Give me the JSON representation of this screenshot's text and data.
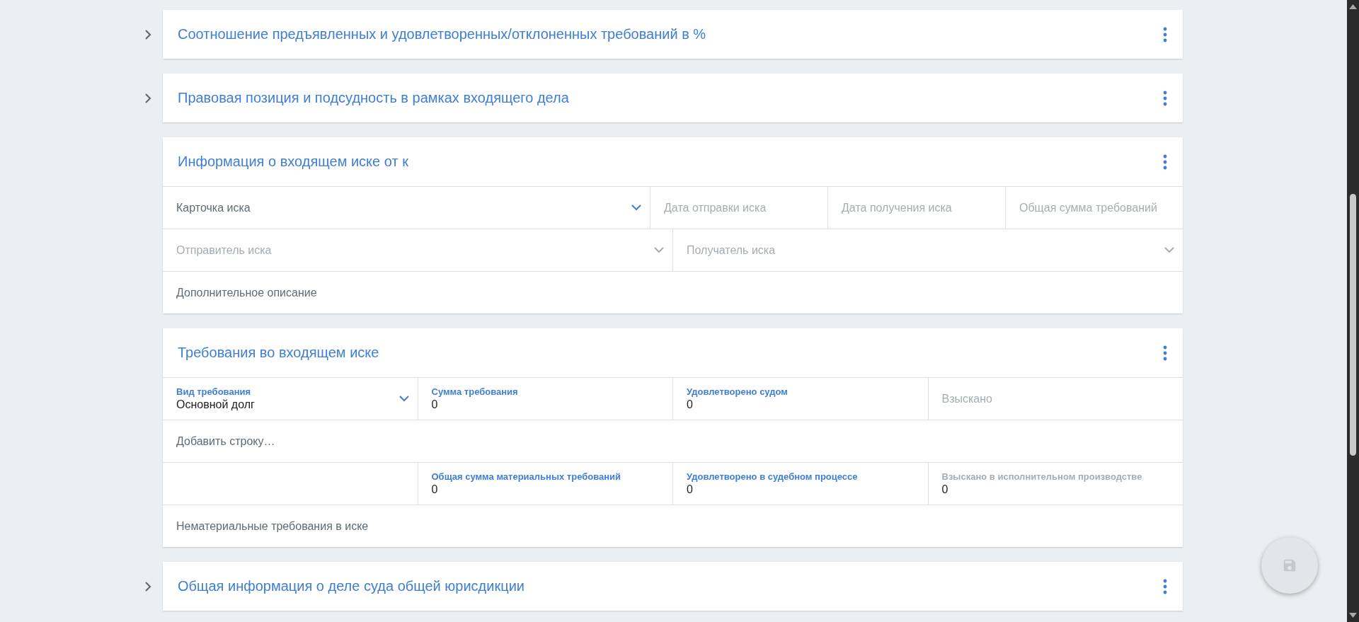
{
  "sections": [
    {
      "title": "Соотношение предъявленных и удовлетворенных/отклоненных требований в %",
      "expanded": false
    },
    {
      "title": "Правовая позиция и подсудность в рамках входящего дела",
      "expanded": false
    },
    {
      "title": "Информация о входящем иске от к",
      "expanded": true,
      "rows": [
        [
          {
            "kind": "select",
            "placeholder": "Карточка иска",
            "disabled": false
          },
          {
            "kind": "input",
            "placeholder": "Дата отправки иска",
            "disabled": true
          },
          {
            "kind": "input",
            "placeholder": "Дата получения иска",
            "disabled": true
          },
          {
            "kind": "input",
            "placeholder": "Общая сумма требований",
            "disabled": true
          }
        ],
        [
          {
            "kind": "select",
            "placeholder": "Отправитель иска",
            "disabled": true
          },
          {
            "kind": "select",
            "placeholder": "Получатель иска",
            "disabled": true
          }
        ],
        [
          {
            "kind": "text",
            "placeholder": "Дополнительное описание",
            "disabled": false
          }
        ]
      ]
    },
    {
      "title": "Требования во входящем иске",
      "expanded": true,
      "rows": [
        [
          {
            "kind": "labeled-select",
            "label": "Вид требования",
            "value": "Основной долг",
            "disabled": false
          },
          {
            "kind": "labeled-input",
            "label": "Сумма требования",
            "value": "0",
            "disabled": false
          },
          {
            "kind": "labeled-input",
            "label": "Удовлетворено судом",
            "value": "0",
            "disabled": false
          },
          {
            "kind": "input",
            "placeholder": "Взыскано",
            "disabled": true
          }
        ],
        [
          {
            "kind": "text",
            "placeholder": "Добавить строку…",
            "disabled": false
          }
        ],
        [
          {
            "kind": "blank"
          },
          {
            "kind": "labeled-input",
            "label": "Общая сумма материальных требований",
            "value": "0",
            "disabled": false
          },
          {
            "kind": "labeled-input",
            "label": "Удовлетворено в судебном процессе",
            "value": "0",
            "disabled": false
          },
          {
            "kind": "labeled-input",
            "label": "Взыскано в исполнительном производстве",
            "value": "0",
            "disabled": true
          }
        ],
        [
          {
            "kind": "text",
            "placeholder": "Нематериальные требования в иске",
            "disabled": false
          }
        ]
      ]
    },
    {
      "title": "Общая информация о деле суда общей юрисдикции",
      "expanded": false
    }
  ],
  "save_button": {
    "disabled": true
  }
}
